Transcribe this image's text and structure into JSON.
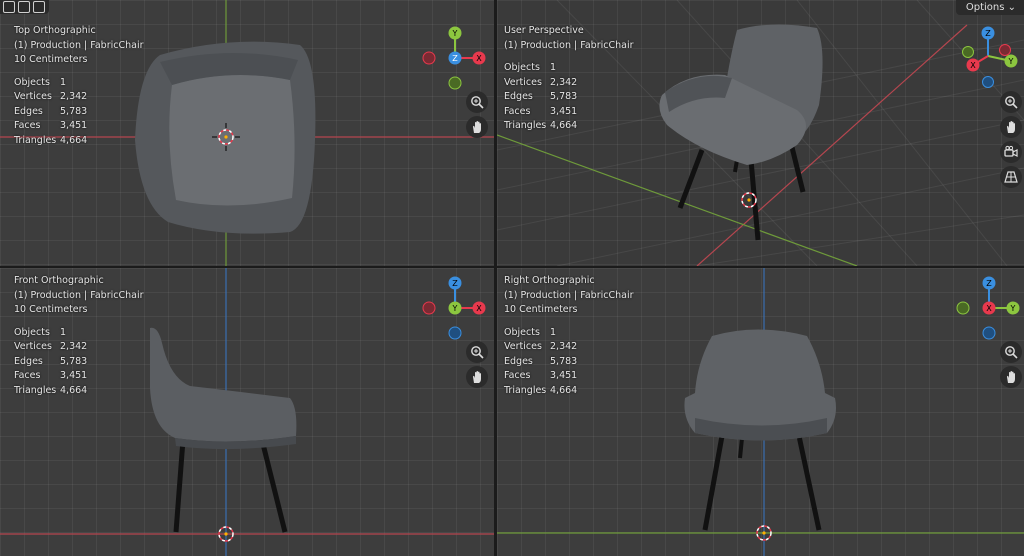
{
  "toolbar": {
    "options_label": "Options ⌄"
  },
  "stats": {
    "labels": {
      "objects": "Objects",
      "vertices": "Vertices",
      "edges": "Edges",
      "faces": "Faces",
      "triangles": "Triangles"
    },
    "values": {
      "objects": "1",
      "vertices": "2,342",
      "edges": "5,783",
      "faces": "3,451",
      "triangles": "4,664"
    }
  },
  "viewports": {
    "top": {
      "title": "Top Orthographic",
      "collection": "(1) Production | FabricChair",
      "scale": "10 Centimeters"
    },
    "user": {
      "title": "User Perspective",
      "collection": "(1) Production | FabricChair",
      "scale": ""
    },
    "front": {
      "title": "Front Orthographic",
      "collection": "(1) Production | FabricChair",
      "scale": "10 Centimeters"
    },
    "right": {
      "title": "Right Orthographic",
      "collection": "(1) Production | FabricChair",
      "scale": "10 Centimeters"
    }
  },
  "axes": {
    "x": "X",
    "y": "Y",
    "z": "Z"
  },
  "colors": {
    "x_axis": "#e8394d",
    "y_axis": "#8cc63f",
    "z_axis": "#3a8fe0",
    "viewport_bg": "#3d3d3d",
    "fabric": "#5f6266"
  },
  "icons": {
    "zoom": "magnifier-plus-icon",
    "pan": "hand-icon",
    "camera": "camera-icon",
    "grid": "perspective-grid-icon"
  }
}
